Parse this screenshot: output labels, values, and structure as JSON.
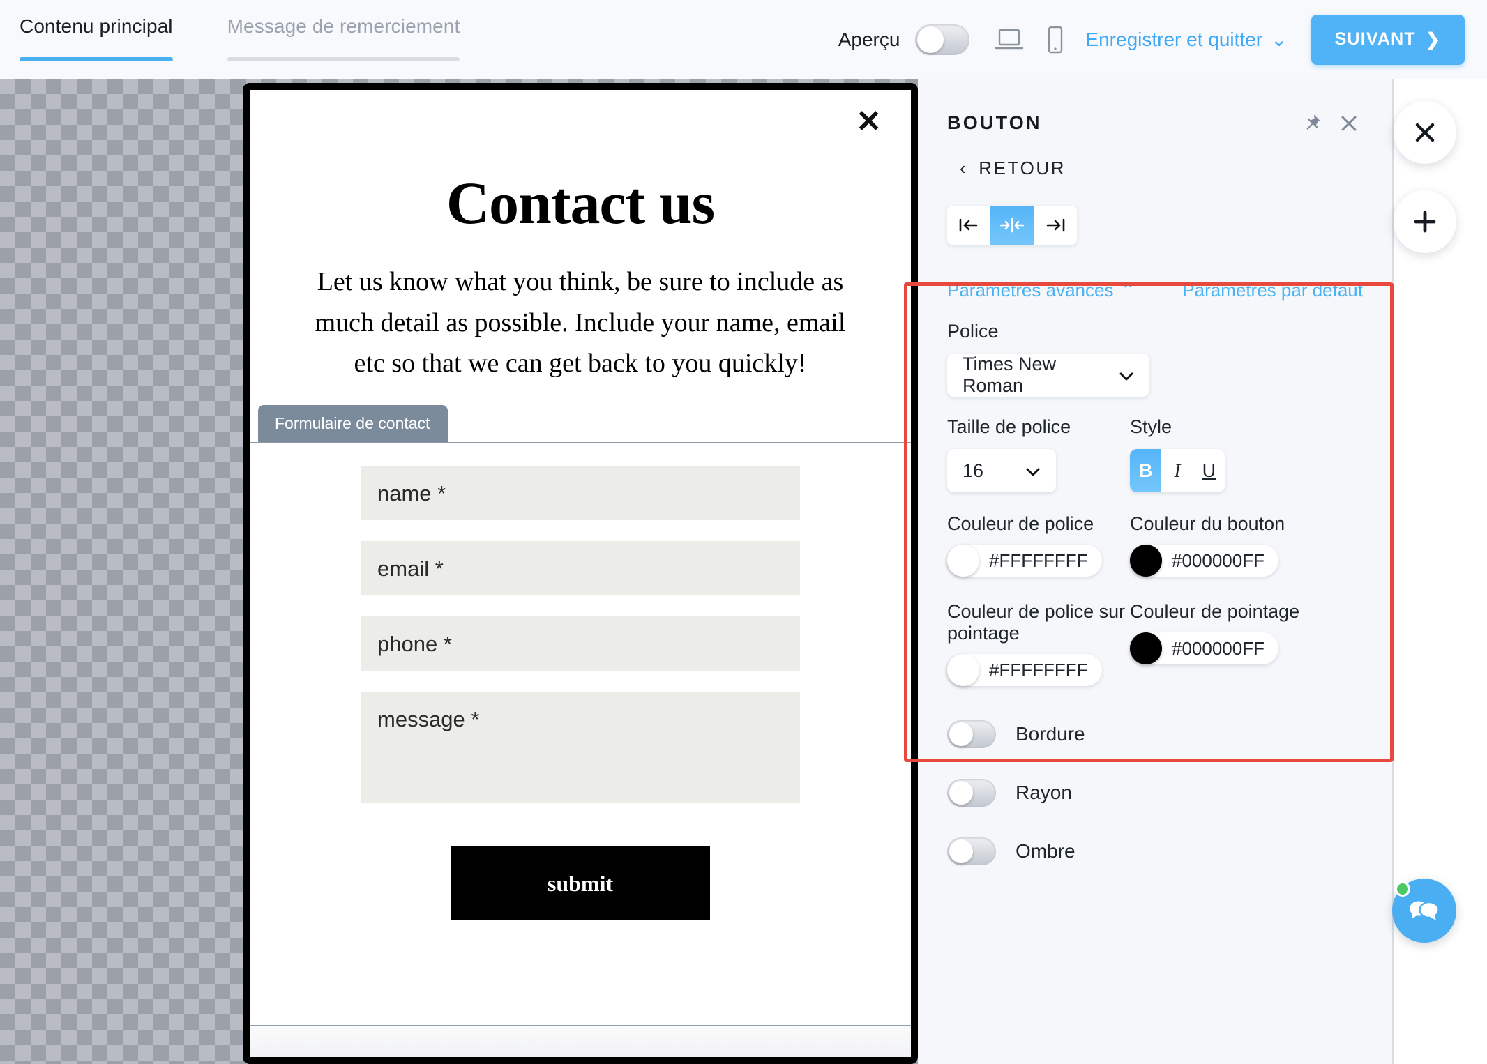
{
  "topbar": {
    "tabs": [
      {
        "label": "Contenu principal",
        "active": true
      },
      {
        "label": "Message de remerciement",
        "active": false
      }
    ],
    "preview_label": "Aperçu",
    "preview_on": false,
    "desktop_icon": "laptop-icon",
    "mobile_icon": "mobile-icon",
    "save_exit_label": "Enregistrer et quitter",
    "save_exit_caret": "⌄",
    "next_label": "SUIVANT",
    "next_caret": "❯",
    "accent_color": "#51b3f7"
  },
  "canvas": {
    "popup": {
      "close_icon": "✕",
      "title": "Contact us",
      "description": "Let us know what you think, be sure to include as much detail as possible. Include your name, email etc so that we can get back to you quickly!",
      "form_tag": "Formulaire de contact",
      "fields": [
        {
          "label": "name *",
          "type": "text"
        },
        {
          "label": "email *",
          "type": "text"
        },
        {
          "label": "phone *",
          "type": "text"
        },
        {
          "label": "message *",
          "type": "textarea"
        }
      ],
      "submit_label": "submit",
      "field_bg": "#ecece8",
      "submit_bg": "#000000",
      "tag_bg": "#7b8b9c"
    }
  },
  "panel": {
    "title": "BOUTON",
    "pin_icon": "pin-icon",
    "close_icon": "✕",
    "back_label": "RETOUR",
    "back_caret": "‹",
    "alignment": {
      "options": [
        {
          "name": "align-left",
          "glyph": "|←",
          "active": false
        },
        {
          "name": "align-center",
          "glyph": "→|←",
          "active": true
        },
        {
          "name": "align-right",
          "glyph": "→|",
          "active": false
        }
      ]
    },
    "advanced_label": "Paramètres avancés",
    "advanced_caret": "⌃",
    "defaults_label": "Paramètres par défaut",
    "font_label": "Police",
    "font_value": "Times New Roman",
    "font_size_label": "Taille de police",
    "font_size_value": "16",
    "style_label": "Style",
    "style_buttons": [
      {
        "name": "bold",
        "glyph": "B",
        "active": true
      },
      {
        "name": "italic",
        "glyph": "I",
        "active": false
      },
      {
        "name": "underline",
        "glyph": "U",
        "active": false
      }
    ],
    "colors": [
      {
        "label": "Couleur de police",
        "value": "#FFFFFFFF",
        "swatch": "#ffffff"
      },
      {
        "label": "Couleur du bouton",
        "value": "#000000FF",
        "swatch": "#000000"
      },
      {
        "label": "Couleur de police sur pointage",
        "value": "#FFFFFFFF",
        "swatch": "#ffffff"
      },
      {
        "label": "Couleur de pointage",
        "value": "#000000FF",
        "swatch": "#000000"
      }
    ],
    "toggles": [
      {
        "label": "Bordure",
        "on": false
      },
      {
        "label": "Rayon",
        "on": false
      },
      {
        "label": "Ombre",
        "on": false
      }
    ],
    "highlight_color": "#e8493f"
  },
  "floating": {
    "close_icon": "✕",
    "add_icon": "＋",
    "chat_icon": "chat-bubbles-icon",
    "chat_color": "#4aaef2",
    "status_color": "#4cc764"
  }
}
